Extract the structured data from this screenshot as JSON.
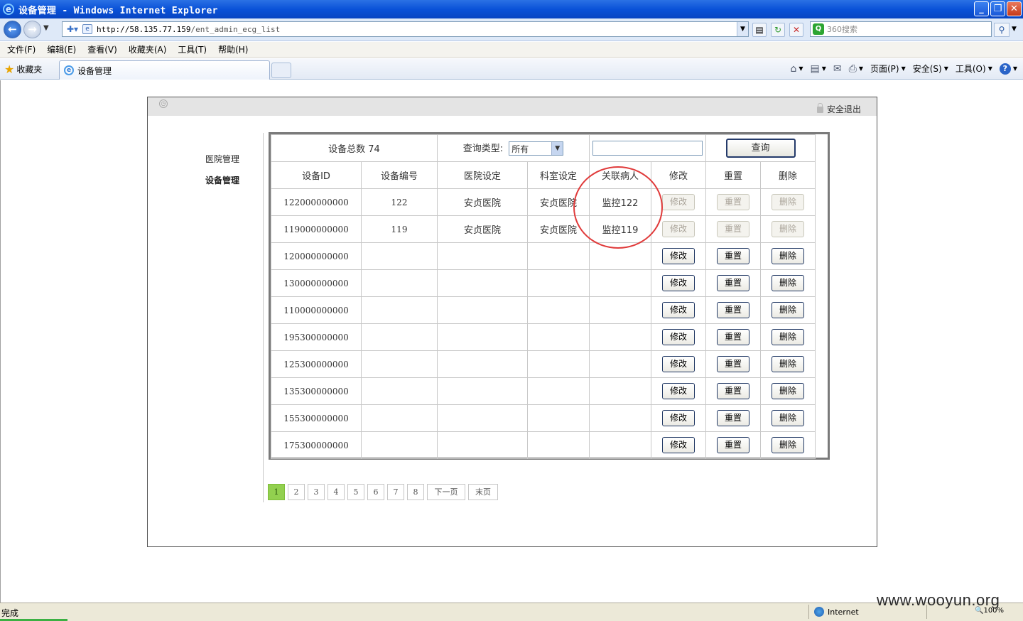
{
  "window": {
    "title": "设备管理 - Windows Internet Explorer",
    "controls": [
      "_",
      "❐",
      "✕"
    ]
  },
  "address_bar": {
    "url_host": "http://58.135.77.159",
    "url_path": "/ent_admin_ecg_list",
    "search_placeholder": "360搜索"
  },
  "menu": [
    "文件(F)",
    "编辑(E)",
    "查看(V)",
    "收藏夹(A)",
    "工具(T)",
    "帮助(H)"
  ],
  "tabs": {
    "favorites_label": "收藏夹",
    "active_tab": "设备管理"
  },
  "command_bar": {
    "page": "页面(P)",
    "safety": "安全(S)",
    "tools": "工具(O)"
  },
  "header": {
    "logout": "安全退出"
  },
  "sidebar": {
    "items": [
      {
        "label": "医院管理",
        "active": false
      },
      {
        "label": "设备管理",
        "active": true
      }
    ]
  },
  "toolbar": {
    "total_label": "设备总数 74",
    "query_type_label": "查询类型:",
    "query_type_selected": "所有",
    "search_value": "",
    "query_button": "查询"
  },
  "table": {
    "columns": [
      "设备ID",
      "设备编号",
      "医院设定",
      "科室设定",
      "关联病人",
      "修改",
      "重置",
      "删除"
    ],
    "action_labels": {
      "edit": "修改",
      "reset": "重置",
      "delete": "删除"
    },
    "rows": [
      {
        "id": "122000000000",
        "number": "122",
        "hospital": "安贞医院",
        "department": "安贞医院",
        "patient": "监控122",
        "actions_enabled": false
      },
      {
        "id": "119000000000",
        "number": "119",
        "hospital": "安贞医院",
        "department": "安贞医院",
        "patient": "监控119",
        "actions_enabled": false
      },
      {
        "id": "120000000000",
        "number": "",
        "hospital": "",
        "department": "",
        "patient": "",
        "actions_enabled": true
      },
      {
        "id": "130000000000",
        "number": "",
        "hospital": "",
        "department": "",
        "patient": "",
        "actions_enabled": true
      },
      {
        "id": "110000000000",
        "number": "",
        "hospital": "",
        "department": "",
        "patient": "",
        "actions_enabled": true
      },
      {
        "id": "195300000000",
        "number": "",
        "hospital": "",
        "department": "",
        "patient": "",
        "actions_enabled": true
      },
      {
        "id": "125300000000",
        "number": "",
        "hospital": "",
        "department": "",
        "patient": "",
        "actions_enabled": true
      },
      {
        "id": "135300000000",
        "number": "",
        "hospital": "",
        "department": "",
        "patient": "",
        "actions_enabled": true
      },
      {
        "id": "155300000000",
        "number": "",
        "hospital": "",
        "department": "",
        "patient": "",
        "actions_enabled": true
      },
      {
        "id": "175300000000",
        "number": "",
        "hospital": "",
        "department": "",
        "patient": "",
        "actions_enabled": true
      }
    ]
  },
  "pagination": {
    "pages": [
      "1",
      "2",
      "3",
      "4",
      "5",
      "6",
      "7",
      "8"
    ],
    "current": "1",
    "next": "下一页",
    "last": "末页"
  },
  "status_bar": {
    "status": "完成",
    "zone": "Internet",
    "zoom": "100%"
  },
  "watermark": "www.wooyun.org",
  "colors": {
    "annotation_circle": "#e03b3b",
    "current_page": "#92d04f",
    "titlebar": "#0a52d8"
  }
}
